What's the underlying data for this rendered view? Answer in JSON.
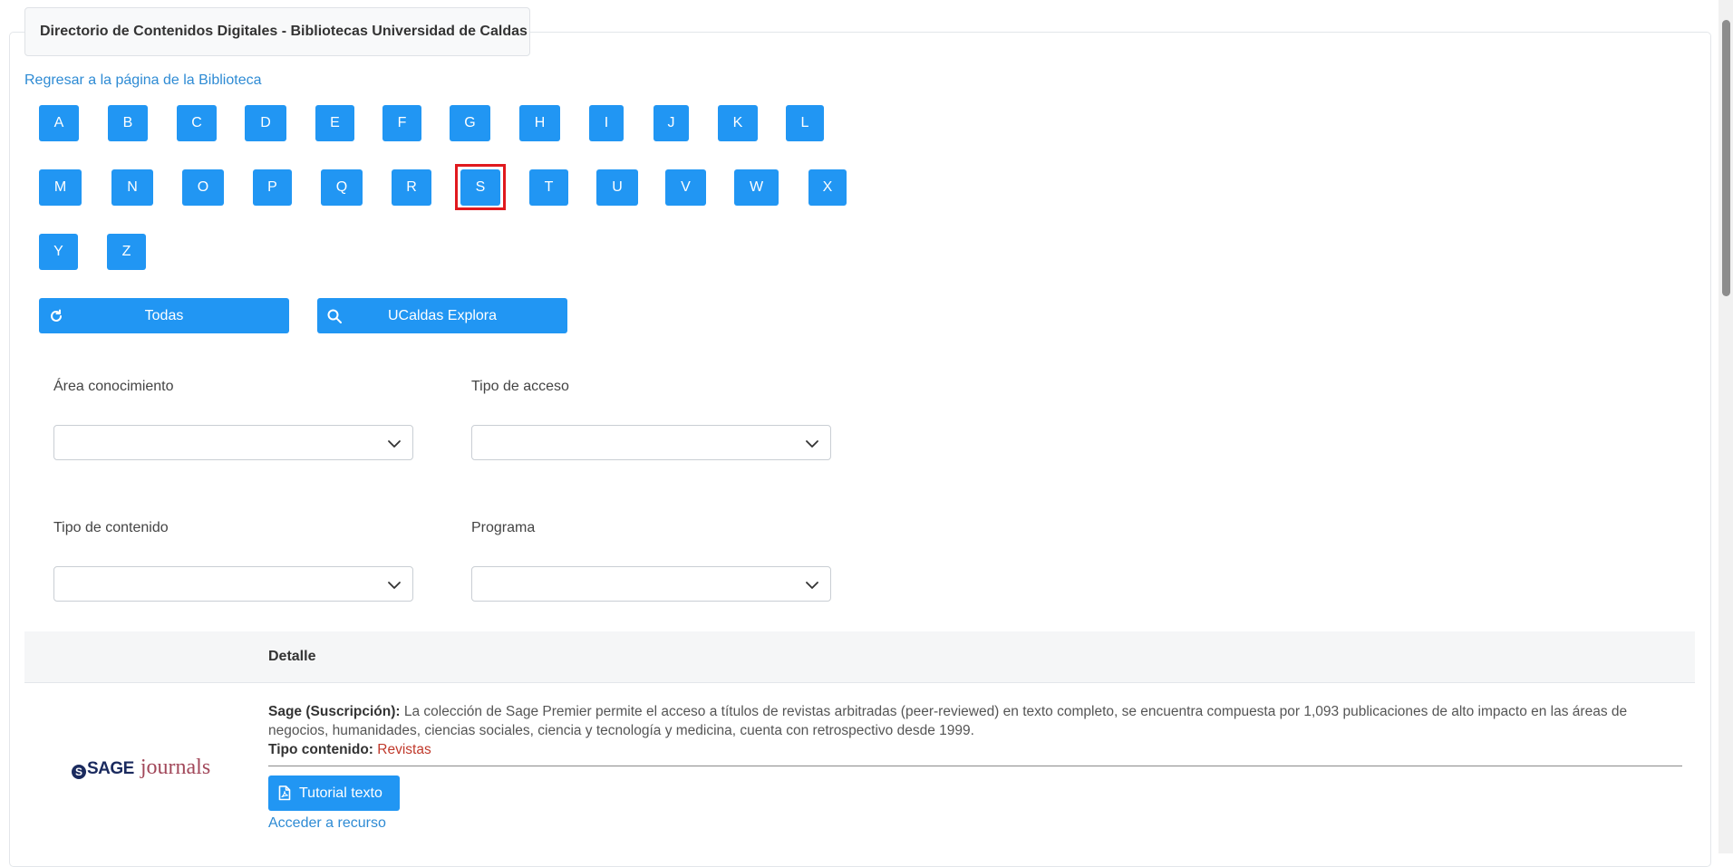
{
  "header": {
    "title": "Directorio de Contenidos Digitales - Bibliotecas Universidad de Caldas"
  },
  "nav": {
    "back_link": "Regresar a la página de la Biblioteca"
  },
  "letters": [
    "A",
    "B",
    "C",
    "D",
    "E",
    "F",
    "G",
    "H",
    "I",
    "J",
    "K",
    "L",
    "M",
    "N",
    "O",
    "P",
    "Q",
    "R",
    "S",
    "T",
    "U",
    "V",
    "W",
    "X",
    "Y",
    "Z"
  ],
  "selected_letter": "S",
  "actions": {
    "all_label": "Todas",
    "explore_label": "UCaldas Explora"
  },
  "filters": {
    "area_label": "Área conocimiento",
    "access_label": "Tipo de acceso",
    "content_label": "Tipo de contenido",
    "program_label": "Programa"
  },
  "table": {
    "detail_header": "Detalle"
  },
  "resource": {
    "logo_sage": "SAGE",
    "logo_journals": "journals",
    "name": "Sage (Suscripción):",
    "description": " La colección de Sage Premier permite el acceso a títulos de revistas arbitradas (peer-reviewed) en texto completo, se encuentra compuesta por 1,093 publicaciones de alto impacto en las áreas de negocios, humanidades, ciencias sociales, ciencia y tecnología y medicina, cuenta con retrospectivo desde 1999.",
    "type_label": "Tipo contenido:",
    "type_value": "Revistas",
    "tutorial_label": "Tutorial texto",
    "access_label": "Acceder a recurso"
  },
  "colors": {
    "button": "#2196f3",
    "link": "#2e8bd4",
    "highlight": "#e0191e",
    "type_value": "#c0392b"
  }
}
